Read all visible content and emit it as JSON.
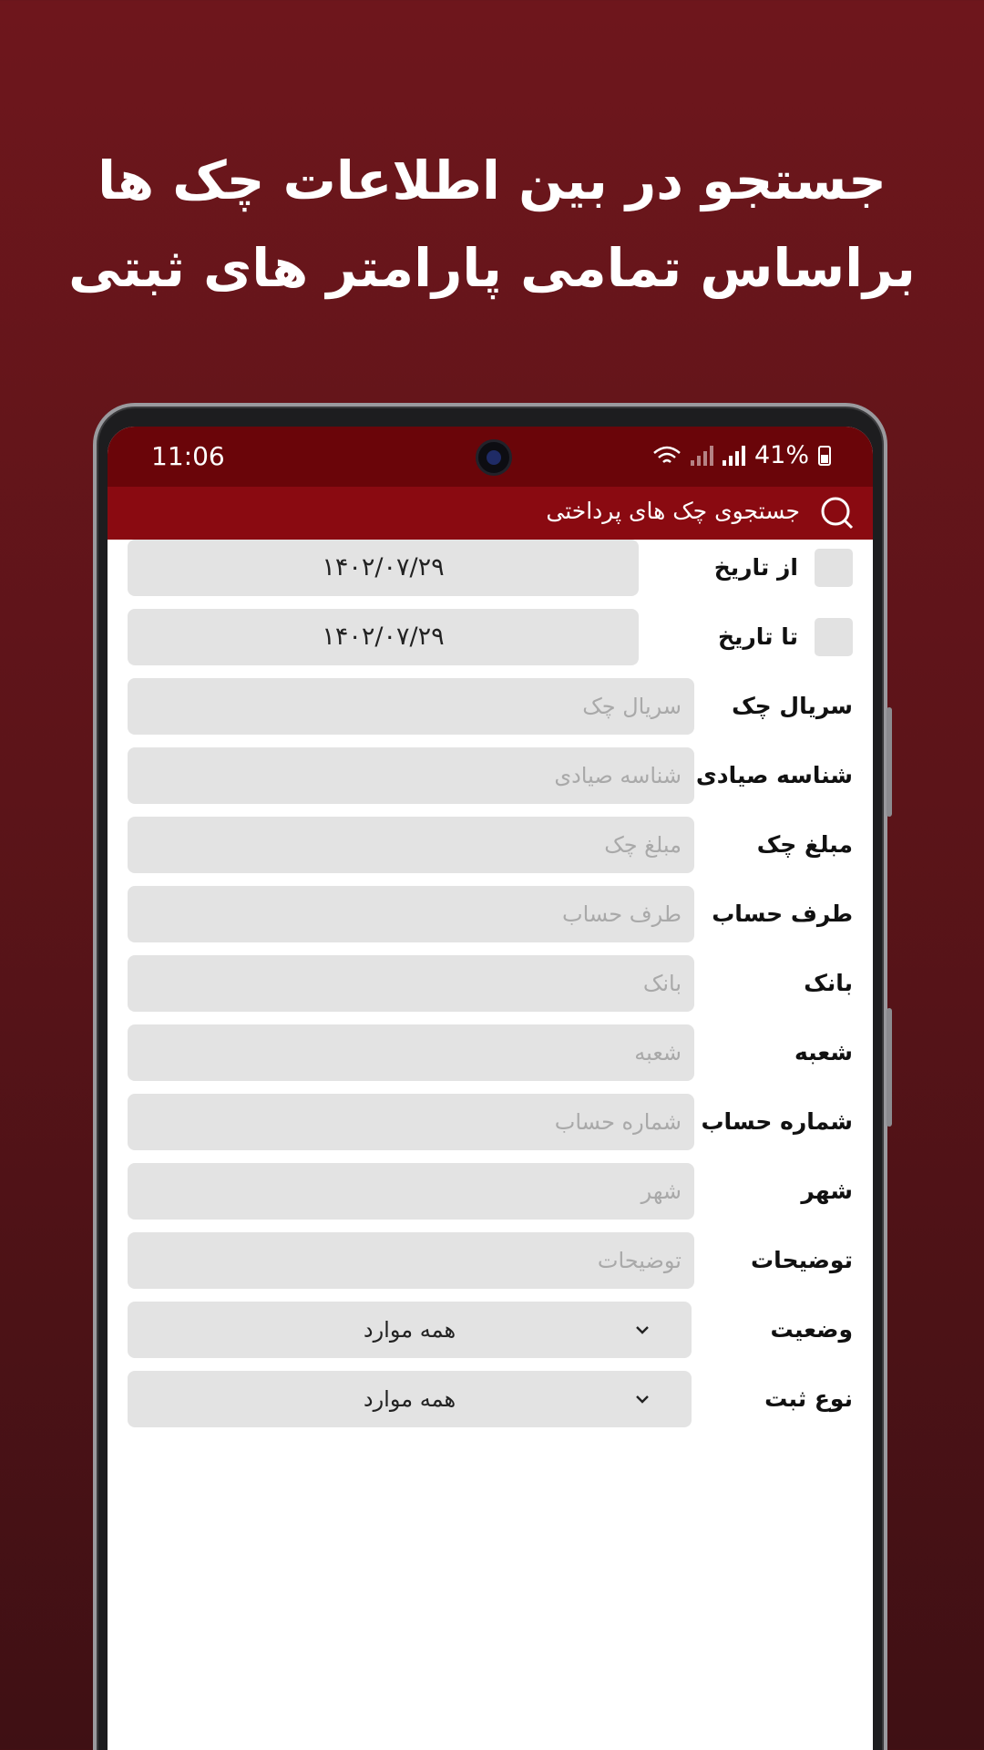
{
  "headline": {
    "line1": "جستجو در بین اطلاعات چک ها",
    "line2": "براساس تمامی پارامتر های ثبتی"
  },
  "status_bar": {
    "time": "11:06",
    "battery": "41%"
  },
  "app_bar": {
    "title": "جستجوی چک های پرداختی",
    "icon": "search-icon"
  },
  "form": {
    "from_date": {
      "label": "از تاریخ",
      "value": "۱۴۰۲/۰۷/۲۹",
      "checked": false
    },
    "to_date": {
      "label": "تا تاریخ",
      "value": "۱۴۰۲/۰۷/۲۹",
      "checked": false
    },
    "fields": [
      {
        "label": "سریال چک",
        "placeholder": "سریال چک"
      },
      {
        "label": "شناسه صیادی",
        "placeholder": "شناسه صیادی"
      },
      {
        "label": "مبلغ چک",
        "placeholder": "مبلغ چک"
      },
      {
        "label": "طرف حساب",
        "placeholder": "طرف حساب"
      },
      {
        "label": "بانک",
        "placeholder": "بانک"
      },
      {
        "label": "شعبه",
        "placeholder": "شعبه"
      },
      {
        "label": "شماره حساب",
        "placeholder": "شماره حساب"
      },
      {
        "label": "شهر",
        "placeholder": "شهر"
      },
      {
        "label": "توضیحات",
        "placeholder": "توضیحات"
      }
    ],
    "status": {
      "label": "وضعیت",
      "value": "همه موارد"
    },
    "record_type": {
      "label": "نوع ثبت",
      "value": "همه موارد"
    }
  },
  "colors": {
    "background": "#5c1419",
    "status_bar": "#6a0509",
    "app_bar": "#8a0a11",
    "input_bg": "#e3e3e3"
  }
}
